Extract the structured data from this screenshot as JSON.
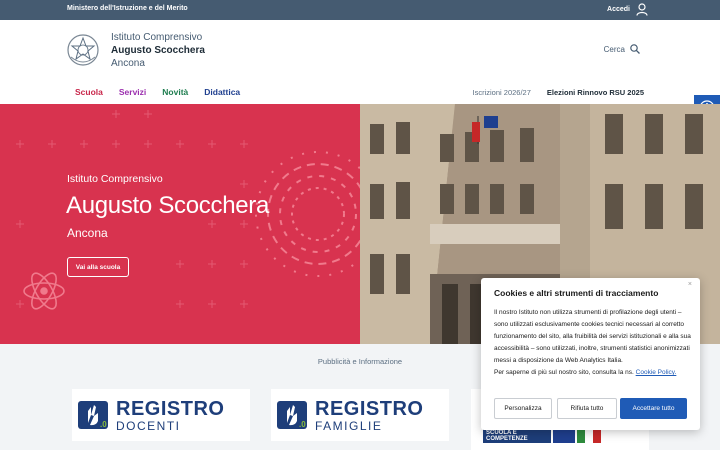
{
  "topbar": {
    "ministry": "Ministero dell'Istruzione e del Merito",
    "login_label": "Accedi"
  },
  "header": {
    "line1": "Istituto Comprensivo",
    "line2": "Augusto Scocchera",
    "line3": "Ancona",
    "search_label": "Cerca"
  },
  "nav": {
    "items": [
      {
        "label": "Scuola",
        "color": "#c8264a"
      },
      {
        "label": "Servizi",
        "color": "#9b2fae"
      },
      {
        "label": "Novità",
        "color": "#1e7d4f"
      },
      {
        "label": "Didattica",
        "color": "#1f3f8f"
      }
    ],
    "right": [
      "Iscrizioni 2026/27",
      "Elezioni Rinnovo RSU 2025"
    ]
  },
  "hero": {
    "subtitle": "Istituto Comprensivo",
    "title": "Augusto Scocchera",
    "city": "Ancona",
    "button": "Vai alla scuola",
    "accent": "#d8334f"
  },
  "lower": {
    "caption": "Pubblicità e Informazione",
    "banners": [
      {
        "word": "REGISTRO",
        "sub": "DOCENTI"
      },
      {
        "word": "REGISTRO",
        "sub": "FAMIGLIE"
      },
      {
        "tag_line1": "SCUOLA E",
        "tag_line2": "COMPETENZE"
      }
    ]
  },
  "cookie": {
    "close": "×",
    "title": "Cookies e altri strumenti di tracciamento",
    "body": "Il nostro Istituto non utilizza strumenti di profilazione degli utenti – sono utilizzati esclusivamente cookies tecnici necessari al corretto funzionamento del sito, alla fruibilità dei servizi istituzionali e alla sua accessibilità – sono utilizzati, inoltre, strumenti statistici anonimizzati messi a disposizione da Web Analytics Italia.",
    "more_prefix": "Per saperne di più sul nostro sito, consulta la ns.",
    "more_link": "Cookie Policy.",
    "btn_customize": "Personalizza",
    "btn_reject": "Rifiuta tutto",
    "btn_accept": "Accettare tutto"
  },
  "icons": [
    "user-icon",
    "search-icon",
    "emblem-icon",
    "accessibility-icon",
    "atom-icon"
  ]
}
